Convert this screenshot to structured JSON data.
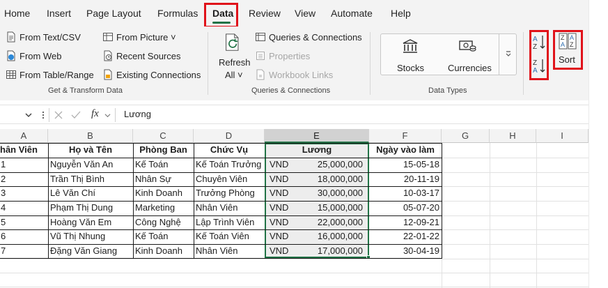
{
  "menu": {
    "items": [
      "Home",
      "Insert",
      "Page Layout",
      "Formulas",
      "Data",
      "Review",
      "View",
      "Automate",
      "Help"
    ],
    "active": "Data"
  },
  "ribbon": {
    "get_transform": {
      "from_text_csv": "From Text/CSV",
      "from_web": "From Web",
      "from_table_range": "From Table/Range",
      "from_picture": "From Picture ˅",
      "recent_sources": "Recent Sources",
      "existing_connections": "Existing Connections",
      "label": "Get & Transform Data"
    },
    "queries": {
      "refresh": "Refresh",
      "refresh_all": "All ˅",
      "queries_connections": "Queries & Connections",
      "properties": "Properties",
      "workbook_links": "Workbook Links",
      "label": "Queries & Connections"
    },
    "data_types": {
      "stocks": "Stocks",
      "currencies": "Currencies",
      "label": "Data Types"
    },
    "sort_filter": {
      "sort_asc_icon": "sort-a-to-z-icon",
      "sort_desc_icon": "sort-z-to-a-icon",
      "sort": "Sort"
    }
  },
  "formula_bar": {
    "fx": "fx",
    "value": "Lương"
  },
  "sheet": {
    "columns": [
      "A",
      "B",
      "C",
      "D",
      "E",
      "F",
      "G",
      "H",
      "I"
    ],
    "selected_column": "E",
    "headers": [
      "hân Viên",
      "Họ và Tên",
      "Phòng Ban",
      "Chức Vụ",
      "Lương",
      "Ngày vào làm"
    ],
    "rows": [
      {
        "id": "1",
        "name": "Nguyễn Văn An",
        "dept": "Kế Toán",
        "role": "Kế Toán Trưởng",
        "cur": "VND",
        "salary": "25,000,000",
        "date": "15-05-18"
      },
      {
        "id": "2",
        "name": "Trần Thị Bình",
        "dept": "Nhân Sự",
        "role": "Chuyên Viên",
        "cur": "VND",
        "salary": "18,000,000",
        "date": "20-11-19"
      },
      {
        "id": "3",
        "name": "Lê Văn Chí",
        "dept": "Kinh Doanh",
        "role": "Trưởng Phòng",
        "cur": "VND",
        "salary": "30,000,000",
        "date": "10-03-17"
      },
      {
        "id": "4",
        "name": "Phạm Thị Dung",
        "dept": "Marketing",
        "role": "Nhân Viên",
        "cur": "VND",
        "salary": "15,000,000",
        "date": "05-07-20"
      },
      {
        "id": "5",
        "name": "Hoàng Văn Em",
        "dept": "Công Nghệ",
        "role": "Lập Trình Viên",
        "cur": "VND",
        "salary": "22,000,000",
        "date": "12-09-21"
      },
      {
        "id": "6",
        "name": "Vũ Thị Nhung",
        "dept": "Kế Toán",
        "role": "Kế Toán Viên",
        "cur": "VND",
        "salary": "16,000,000",
        "date": "22-01-22"
      },
      {
        "id": "7",
        "name": "Đặng Văn Giang",
        "dept": "Kinh Doanh",
        "role": "Nhân Viên",
        "cur": "VND",
        "salary": "17,000,000",
        "date": "30-04-19"
      }
    ]
  },
  "colors": {
    "accent": "#217346",
    "highlight": "#e0121a",
    "ribbon_bg": "#f3f3f3"
  }
}
